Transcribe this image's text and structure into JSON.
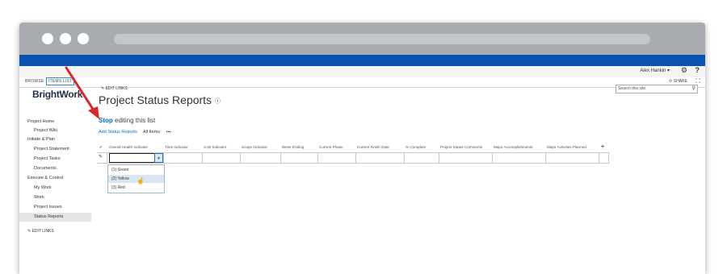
{
  "user": {
    "name": "Alex Hankin ▾",
    "gear_icon": "gear-icon",
    "help": "?"
  },
  "ribbon": {
    "tabs": [
      "BROWSE",
      "ITEMS",
      "LIST"
    ],
    "share": "SHARE",
    "focus_icon": "focus-icon"
  },
  "site": {
    "logo": "BrightWork"
  },
  "nav": {
    "items": [
      "Project Home",
      "Project Wiki",
      "Initiate & Plan",
      "Project Statement",
      "Project Tasks",
      "Documents",
      "Execute & Control",
      "My Work",
      "Work",
      "Project Issues",
      "Status Reports"
    ],
    "edit_links": "EDIT LINKS"
  },
  "header": {
    "edit_links": "EDIT LINKS",
    "title": "Project Status Reports",
    "info_icon": "ⓘ"
  },
  "search": {
    "placeholder": "Search this site"
  },
  "editing": {
    "stop": "Stop",
    "rest": " editing this list"
  },
  "views": {
    "add": "Add Status Reports",
    "all": "All Items",
    "more": "•••"
  },
  "grid": {
    "columns": [
      "Overall Health Indicator",
      "Time Indicator",
      "Cost Indicator",
      "Scope Indicator",
      "Week Ending",
      "Current Phase",
      "Current Finish Date",
      "% Complete",
      "Project Status Comments",
      "Major Accomplishments",
      "Major Activities Planned"
    ],
    "add_column": "+",
    "checkmark": "✔"
  },
  "dropdown": {
    "options": [
      "(1) Green",
      "(2) Yellow",
      "(3) Red"
    ],
    "hovered_index": 1
  },
  "colors": {
    "suitebar": "#0a53b0",
    "link": "#0072c6",
    "annotation_arrow": "#d9262b"
  }
}
